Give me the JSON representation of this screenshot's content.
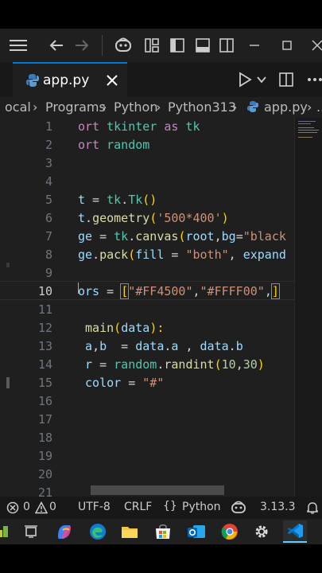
{
  "tab": {
    "filename": "app.py"
  },
  "breadcrumbs": [
    "ocal",
    "Programs",
    "Python",
    "Python313",
    "app.py",
    "..."
  ],
  "line_numbers": [
    "1",
    "2",
    "3",
    "4",
    "5",
    "6",
    "7",
    "8",
    "9",
    "10",
    "11",
    "12",
    "13",
    "14",
    "15",
    "16",
    "17",
    "18",
    "19",
    "20",
    "21"
  ],
  "code": {
    "l1": [
      "ort ",
      "tkinter",
      " as ",
      "tk"
    ],
    "l2": [
      "ort ",
      "random"
    ],
    "l5": [
      "t",
      " = ",
      "tk",
      ".",
      "Tk",
      "()"
    ],
    "l6": [
      "t",
      ".",
      "geometry",
      "(",
      "'500*400'",
      ")"
    ],
    "l7": [
      "ge",
      " = ",
      "tk",
      ".",
      "canvas",
      "(",
      "root",
      ",",
      "bg",
      "=",
      "\"black"
    ],
    "l8": [
      "ge",
      ".",
      "pack",
      "(",
      "fill",
      " = ",
      "\"both\"",
      ", ",
      "expand"
    ],
    "l10": [
      "ors",
      " = ",
      "[",
      "\"#FF4500\"",
      ",",
      "\"#FFFF00\"",
      ",",
      "]"
    ],
    "l12": [
      " ",
      "main",
      "(",
      "data",
      "):"
    ],
    "l13": [
      " ",
      "a",
      ",",
      "b",
      "  = ",
      "data",
      ".",
      "a",
      " , ",
      "data",
      ".",
      "b"
    ],
    "l14": [
      " ",
      "r",
      " = ",
      "random",
      ".",
      "randint",
      "(",
      "10",
      ",",
      "30",
      ")"
    ],
    "l15": [
      " ",
      "color",
      " = ",
      "\"#\""
    ]
  },
  "status": {
    "errors": "0",
    "warnings": "0",
    "encoding": "UTF-8",
    "eol": "CRLF",
    "language_braces": "{}",
    "language": "Python",
    "version": "3.13.3"
  },
  "colors": {
    "accent": "#0078d4",
    "editor_bg": "#1f1f1f"
  }
}
